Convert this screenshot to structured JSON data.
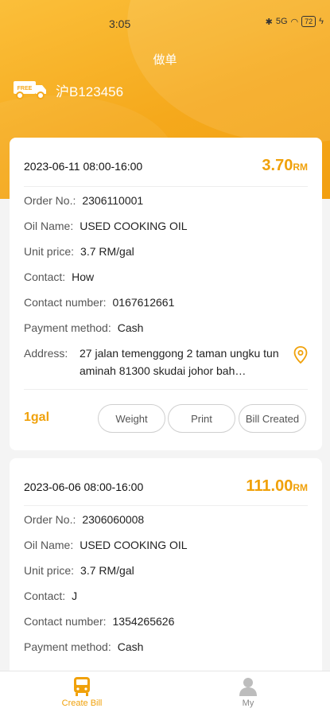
{
  "status": {
    "time": "3:05",
    "signal": "5G",
    "battery": "72"
  },
  "header": {
    "title": "做单",
    "truck_badge": "FREE",
    "plate": "沪B123456"
  },
  "orders": [
    {
      "date": "2023-06-11 08:00-16:00",
      "amount": "3.70",
      "currency": "RM",
      "order_label": "Order No.:",
      "order_no": "2306110001",
      "oil_label": "Oil Name:",
      "oil_name": "USED COOKING OIL",
      "price_label": "Unit price:",
      "unit_price": "3.7 RM/gal",
      "contact_label": "Contact:",
      "contact": "How",
      "phone_label": "Contact number:",
      "phone": "0167612661",
      "payment_label": "Payment method:",
      "payment": "Cash",
      "address_label": "Address:",
      "address": "27 jalan temenggong 2 taman ungku tun aminah 81300 skudai johor bah…",
      "quantity": "1gal",
      "buttons": {
        "weight": "Weight",
        "print": "Print",
        "bill": "Bill Created"
      }
    },
    {
      "date": "2023-06-06 08:00-16:00",
      "amount": "111.00",
      "currency": "RM",
      "order_label": "Order No.:",
      "order_no": "2306060008",
      "oil_label": "Oil Name:",
      "oil_name": "USED COOKING OIL",
      "price_label": "Unit price:",
      "unit_price": "3.7 RM/gal",
      "contact_label": "Contact:",
      "contact": "J",
      "phone_label": "Contact number:",
      "phone": "1354265626",
      "payment_label": "Payment method:",
      "payment": "Cash"
    }
  ],
  "tabs": {
    "create_bill": "Create Bill",
    "my": "My"
  },
  "colors": {
    "accent": "#f0a10a",
    "hero": "#f5a91c"
  }
}
